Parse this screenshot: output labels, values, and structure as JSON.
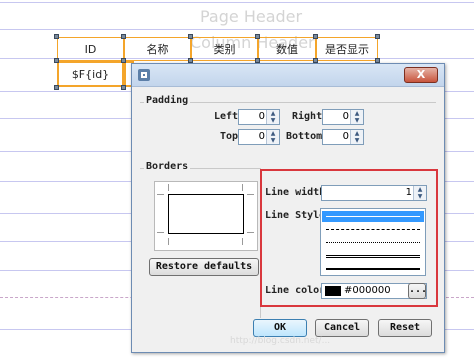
{
  "designer": {
    "page_header": "Page Header",
    "column_header": "Column Header",
    "header_cells": [
      "ID",
      "名称",
      "类别",
      "数值",
      "是否显示"
    ],
    "body_cells": [
      "$F{id}",
      "",
      "",
      "",
      ""
    ]
  },
  "dialog": {
    "close_label": "X",
    "padding": {
      "title": "Padding",
      "left_label": "Left",
      "left_value": "0",
      "right_label": "Right",
      "right_value": "0",
      "top_label": "Top",
      "top_value": "0",
      "bottom_label": "Bottom",
      "bottom_value": "0"
    },
    "borders": {
      "title": "Borders",
      "restore_label": "Restore defaults"
    },
    "line": {
      "width_label": "Line width",
      "width_value": "1",
      "style_label": "Line Style",
      "styles": [
        "solid",
        "dashed",
        "dotted",
        "double",
        "thick"
      ],
      "selected_style": "solid",
      "color_label": "Line color",
      "color_value": "#000000",
      "color_button": "..."
    },
    "buttons": {
      "ok": "OK",
      "cancel": "Cancel",
      "reset": "Reset"
    }
  },
  "watermark": "http://blog.csdn.net/..."
}
